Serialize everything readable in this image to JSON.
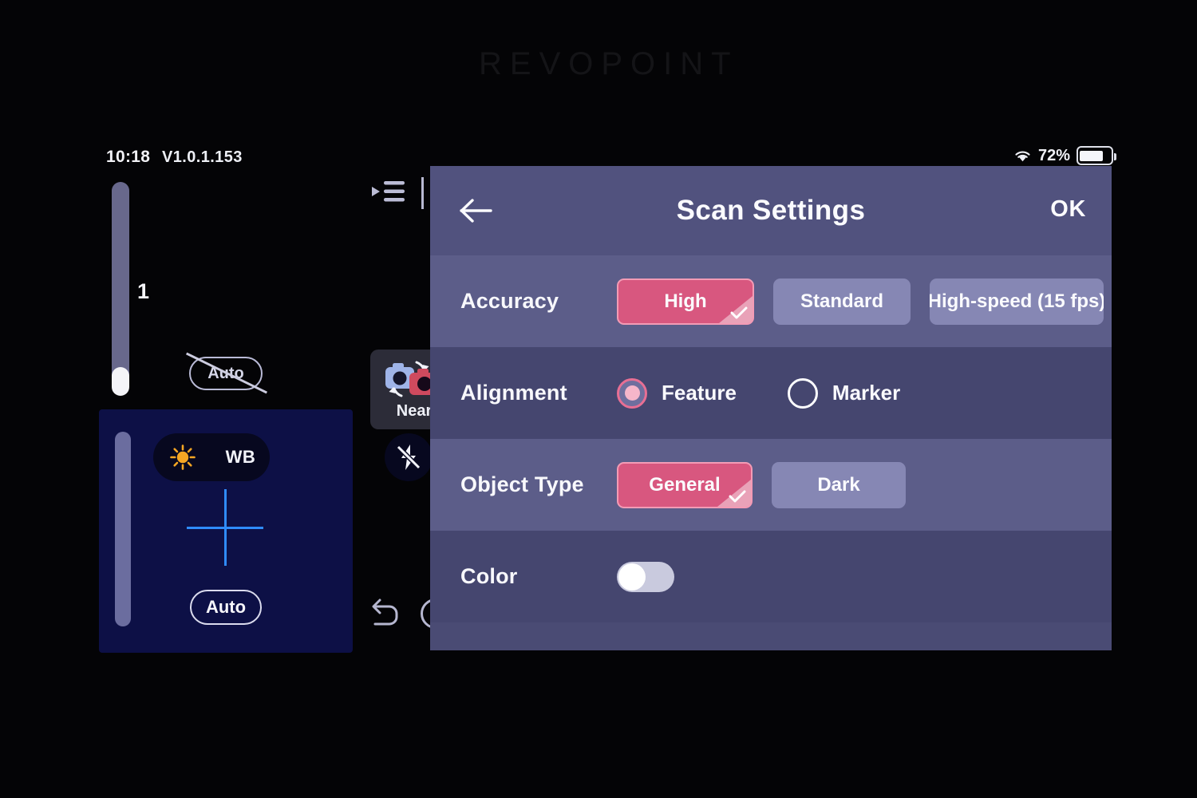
{
  "brand": "REVOPOINT",
  "status_bar": {
    "time": "10:18",
    "version": "V1.0.1.153",
    "wifi_icon": "wifi-icon",
    "battery_percent": "72%",
    "battery_icon": "battery-icon"
  },
  "left_panel": {
    "slider": {
      "name": "exposure-slider",
      "value": "1"
    },
    "auto_disabled_pill": {
      "label": "Auto",
      "icon": "auto-disabled-strikethrough-icon"
    },
    "camera_controls": {
      "brightness_icon": "sun-icon",
      "white_balance_label": "WB",
      "flash_icon": "flash-off-icon",
      "crosshair_icon": "crosshair-icon",
      "auto_button_label": "Auto",
      "crosshair_color": "#2f8bfb",
      "panel_color": "#0d1046"
    }
  },
  "app_chrome": {
    "collapse_icon": "collapse-menu-icon",
    "near_card": {
      "label": "Near",
      "icon": "camera-switch-icon"
    },
    "undo_icon": "undo-icon",
    "record_icon": "record-circle-icon"
  },
  "dialog": {
    "back_icon": "back-arrow-icon",
    "title": "Scan Settings",
    "ok_label": "OK",
    "accent_color": "#d8577f",
    "rows": [
      {
        "label": "Accuracy",
        "type": "segmented",
        "options": [
          {
            "label": "High",
            "selected": true
          },
          {
            "label": "Standard",
            "selected": false
          },
          {
            "label": "High-speed (15 fps)",
            "selected": false
          }
        ]
      },
      {
        "label": "Alignment",
        "type": "radio",
        "options": [
          {
            "label": "Feature",
            "selected": true
          },
          {
            "label": "Marker",
            "selected": false
          }
        ]
      },
      {
        "label": "Object Type",
        "type": "segmented",
        "options": [
          {
            "label": "General",
            "selected": true
          },
          {
            "label": "Dark",
            "selected": false
          }
        ]
      },
      {
        "label": "Color",
        "type": "toggle",
        "value": "off"
      }
    ]
  }
}
